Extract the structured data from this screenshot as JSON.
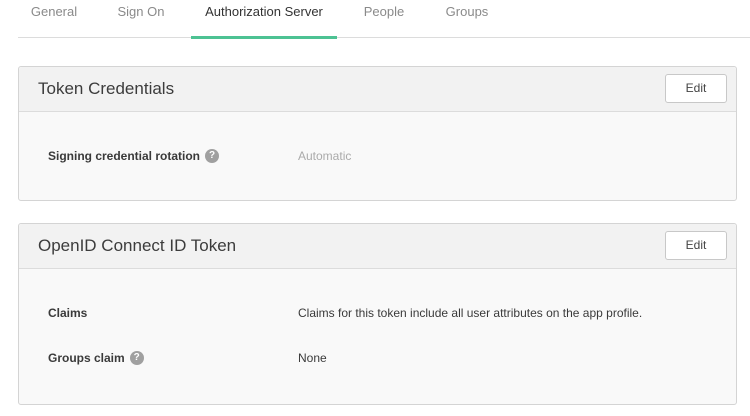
{
  "tabs": [
    {
      "label": "General"
    },
    {
      "label": "Sign On"
    },
    {
      "label": "Authorization Server",
      "active": true
    },
    {
      "label": "People"
    },
    {
      "label": "Groups"
    }
  ],
  "token_credentials": {
    "title": "Token Credentials",
    "edit_label": "Edit",
    "rows": [
      {
        "label": "Signing credential rotation",
        "help": "?",
        "value": "Automatic"
      }
    ]
  },
  "openid_token": {
    "title": "OpenID Connect ID Token",
    "edit_label": "Edit",
    "rows": [
      {
        "label": "Claims",
        "value": "Claims for this token include all user attributes on the app profile."
      },
      {
        "label": "Groups claim",
        "help": "?",
        "value": "None"
      }
    ]
  },
  "colors": {
    "accent": "#4dc293",
    "muted_text": "#aaaaaa",
    "help_icon": "#a0a0a0"
  }
}
